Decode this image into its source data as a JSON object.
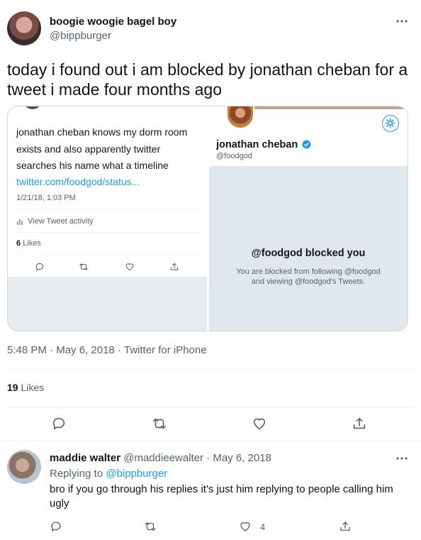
{
  "tweet": {
    "author": {
      "name": "boogie woogie bagel boy",
      "handle": "@bippburger"
    },
    "more_icon": "more-dots-icon",
    "text": "today i found out i am blocked by jonathan cheban for a tweet i made four months ago",
    "meta": {
      "time": "5:48 PM",
      "date": "May 6, 2018",
      "source": "Twitter for iPhone",
      "sep": "·"
    },
    "likes": {
      "count": "19",
      "label": "Likes"
    }
  },
  "left_shot": {
    "text": "jonathan cheban knows my dorm room exists and also apparently twitter searches his name what a timeline",
    "link": "twitter.com/foodgod/status...",
    "timestamp": "1/21/18, 1:03 PM",
    "activity": "View Tweet activity",
    "likes_count": "6",
    "likes_label": "Likes"
  },
  "right_shot": {
    "name": "jonathan cheban",
    "handle": "@foodgod",
    "blocked_title": "@foodgod blocked you",
    "blocked_line1": "You are blocked from following @foodgod",
    "blocked_line2": "and viewing @foodgod's Tweets."
  },
  "reply": {
    "author": {
      "name": "maddie walter",
      "handle": "@maddieewalter",
      "date": "May 6, 2018",
      "sep": "·"
    },
    "replying_prefix": "Replying to",
    "replying_handle": "@bippburger",
    "text": "bro if you go through his replies it's just him replying to people calling him ugly",
    "like_count": "4"
  },
  "colors": {
    "accent": "#1d9bf0",
    "muted": "#536471",
    "border": "#eff3f4",
    "verified": "#1d9bf0"
  }
}
